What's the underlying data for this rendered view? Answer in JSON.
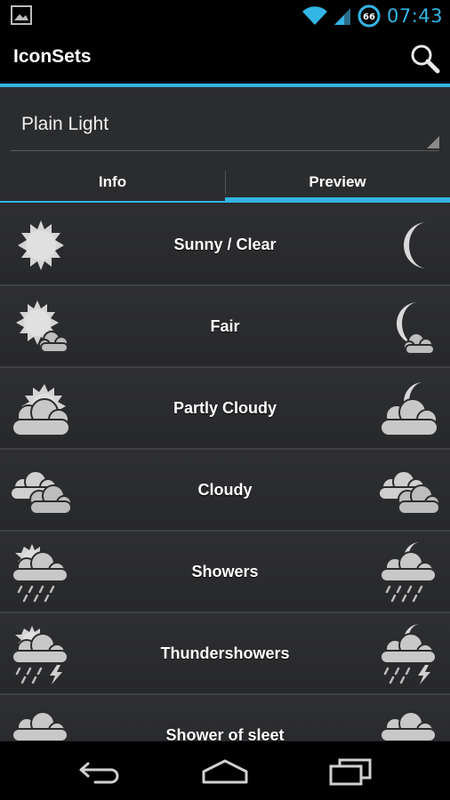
{
  "status_bar": {
    "time": "07:43",
    "battery_level": "66",
    "icons": [
      "picture-icon",
      "wifi-icon",
      "signal-icon",
      "battery-icon"
    ],
    "accent": "#33b5e5"
  },
  "action_bar": {
    "title": "IconSets",
    "search_icon": "search-icon"
  },
  "spinner": {
    "selected": "Plain Light"
  },
  "tabs": [
    {
      "label": "Info",
      "selected": false
    },
    {
      "label": "Preview",
      "selected": true
    }
  ],
  "conditions": [
    {
      "label": "Sunny / Clear",
      "day_icon": "sun-icon",
      "night_icon": "moon-icon"
    },
    {
      "label": "Fair",
      "day_icon": "sun-small-cloud-icon",
      "night_icon": "moon-small-cloud-icon"
    },
    {
      "label": "Partly Cloudy",
      "day_icon": "sun-cloud-icon",
      "night_icon": "moon-cloud-icon"
    },
    {
      "label": "Cloudy",
      "day_icon": "clouds-icon",
      "night_icon": "clouds-icon"
    },
    {
      "label": "Showers",
      "day_icon": "sun-cloud-rain-icon",
      "night_icon": "moon-cloud-rain-icon"
    },
    {
      "label": "Thundershowers",
      "day_icon": "sun-cloud-thunder-icon",
      "night_icon": "moon-cloud-thunder-icon"
    },
    {
      "label": "Shower of sleet",
      "day_icon": "cloud-sleet-icon",
      "night_icon": "cloud-sleet-icon"
    }
  ],
  "nav_bar": {
    "buttons": [
      "back-icon",
      "home-icon",
      "recent-apps-icon"
    ]
  },
  "colors": {
    "accent": "#33b5e5",
    "list_background": "#2b2c2e",
    "icon_fill": "#d4d4d4"
  }
}
